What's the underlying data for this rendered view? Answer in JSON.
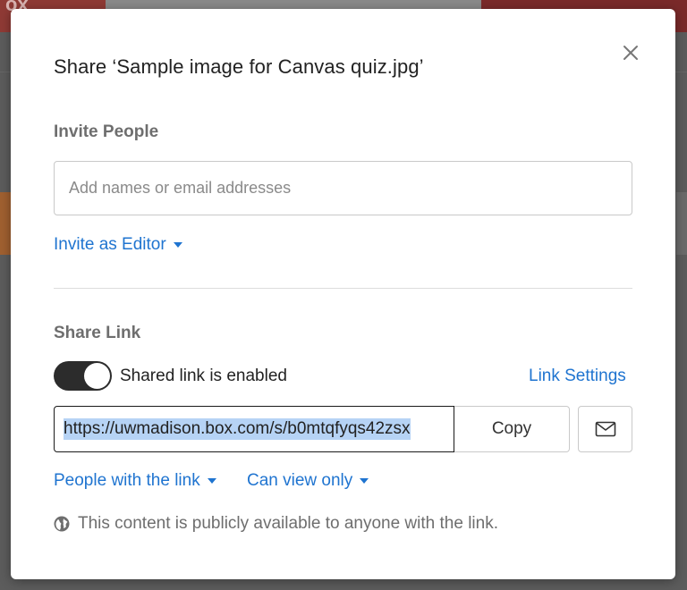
{
  "background": {
    "logo_text": "ox"
  },
  "dialog": {
    "title": "Share ‘Sample image for Canvas quiz.jpg’",
    "close_icon": "close-icon",
    "invite": {
      "label": "Invite People",
      "placeholder": "Add names or email addresses",
      "value": "",
      "role_label": "Invite as Editor"
    },
    "share_link": {
      "label": "Share Link",
      "toggle_on": true,
      "toggle_text": "Shared link is enabled",
      "settings_label": "Link Settings",
      "url": "https://uwmadison.box.com/s/b0mtqfyqs42zsx",
      "copy_label": "Copy",
      "email_icon": "envelope-icon",
      "access_label": "People with the link",
      "permission_label": "Can view only",
      "public_note": "This content is publicly available to anyone with the link.",
      "public_icon": "globe-icon"
    }
  },
  "colors": {
    "accent": "#1f74d0",
    "toggle_on": "#2c2c2c",
    "selection": "#b6d3f5"
  }
}
